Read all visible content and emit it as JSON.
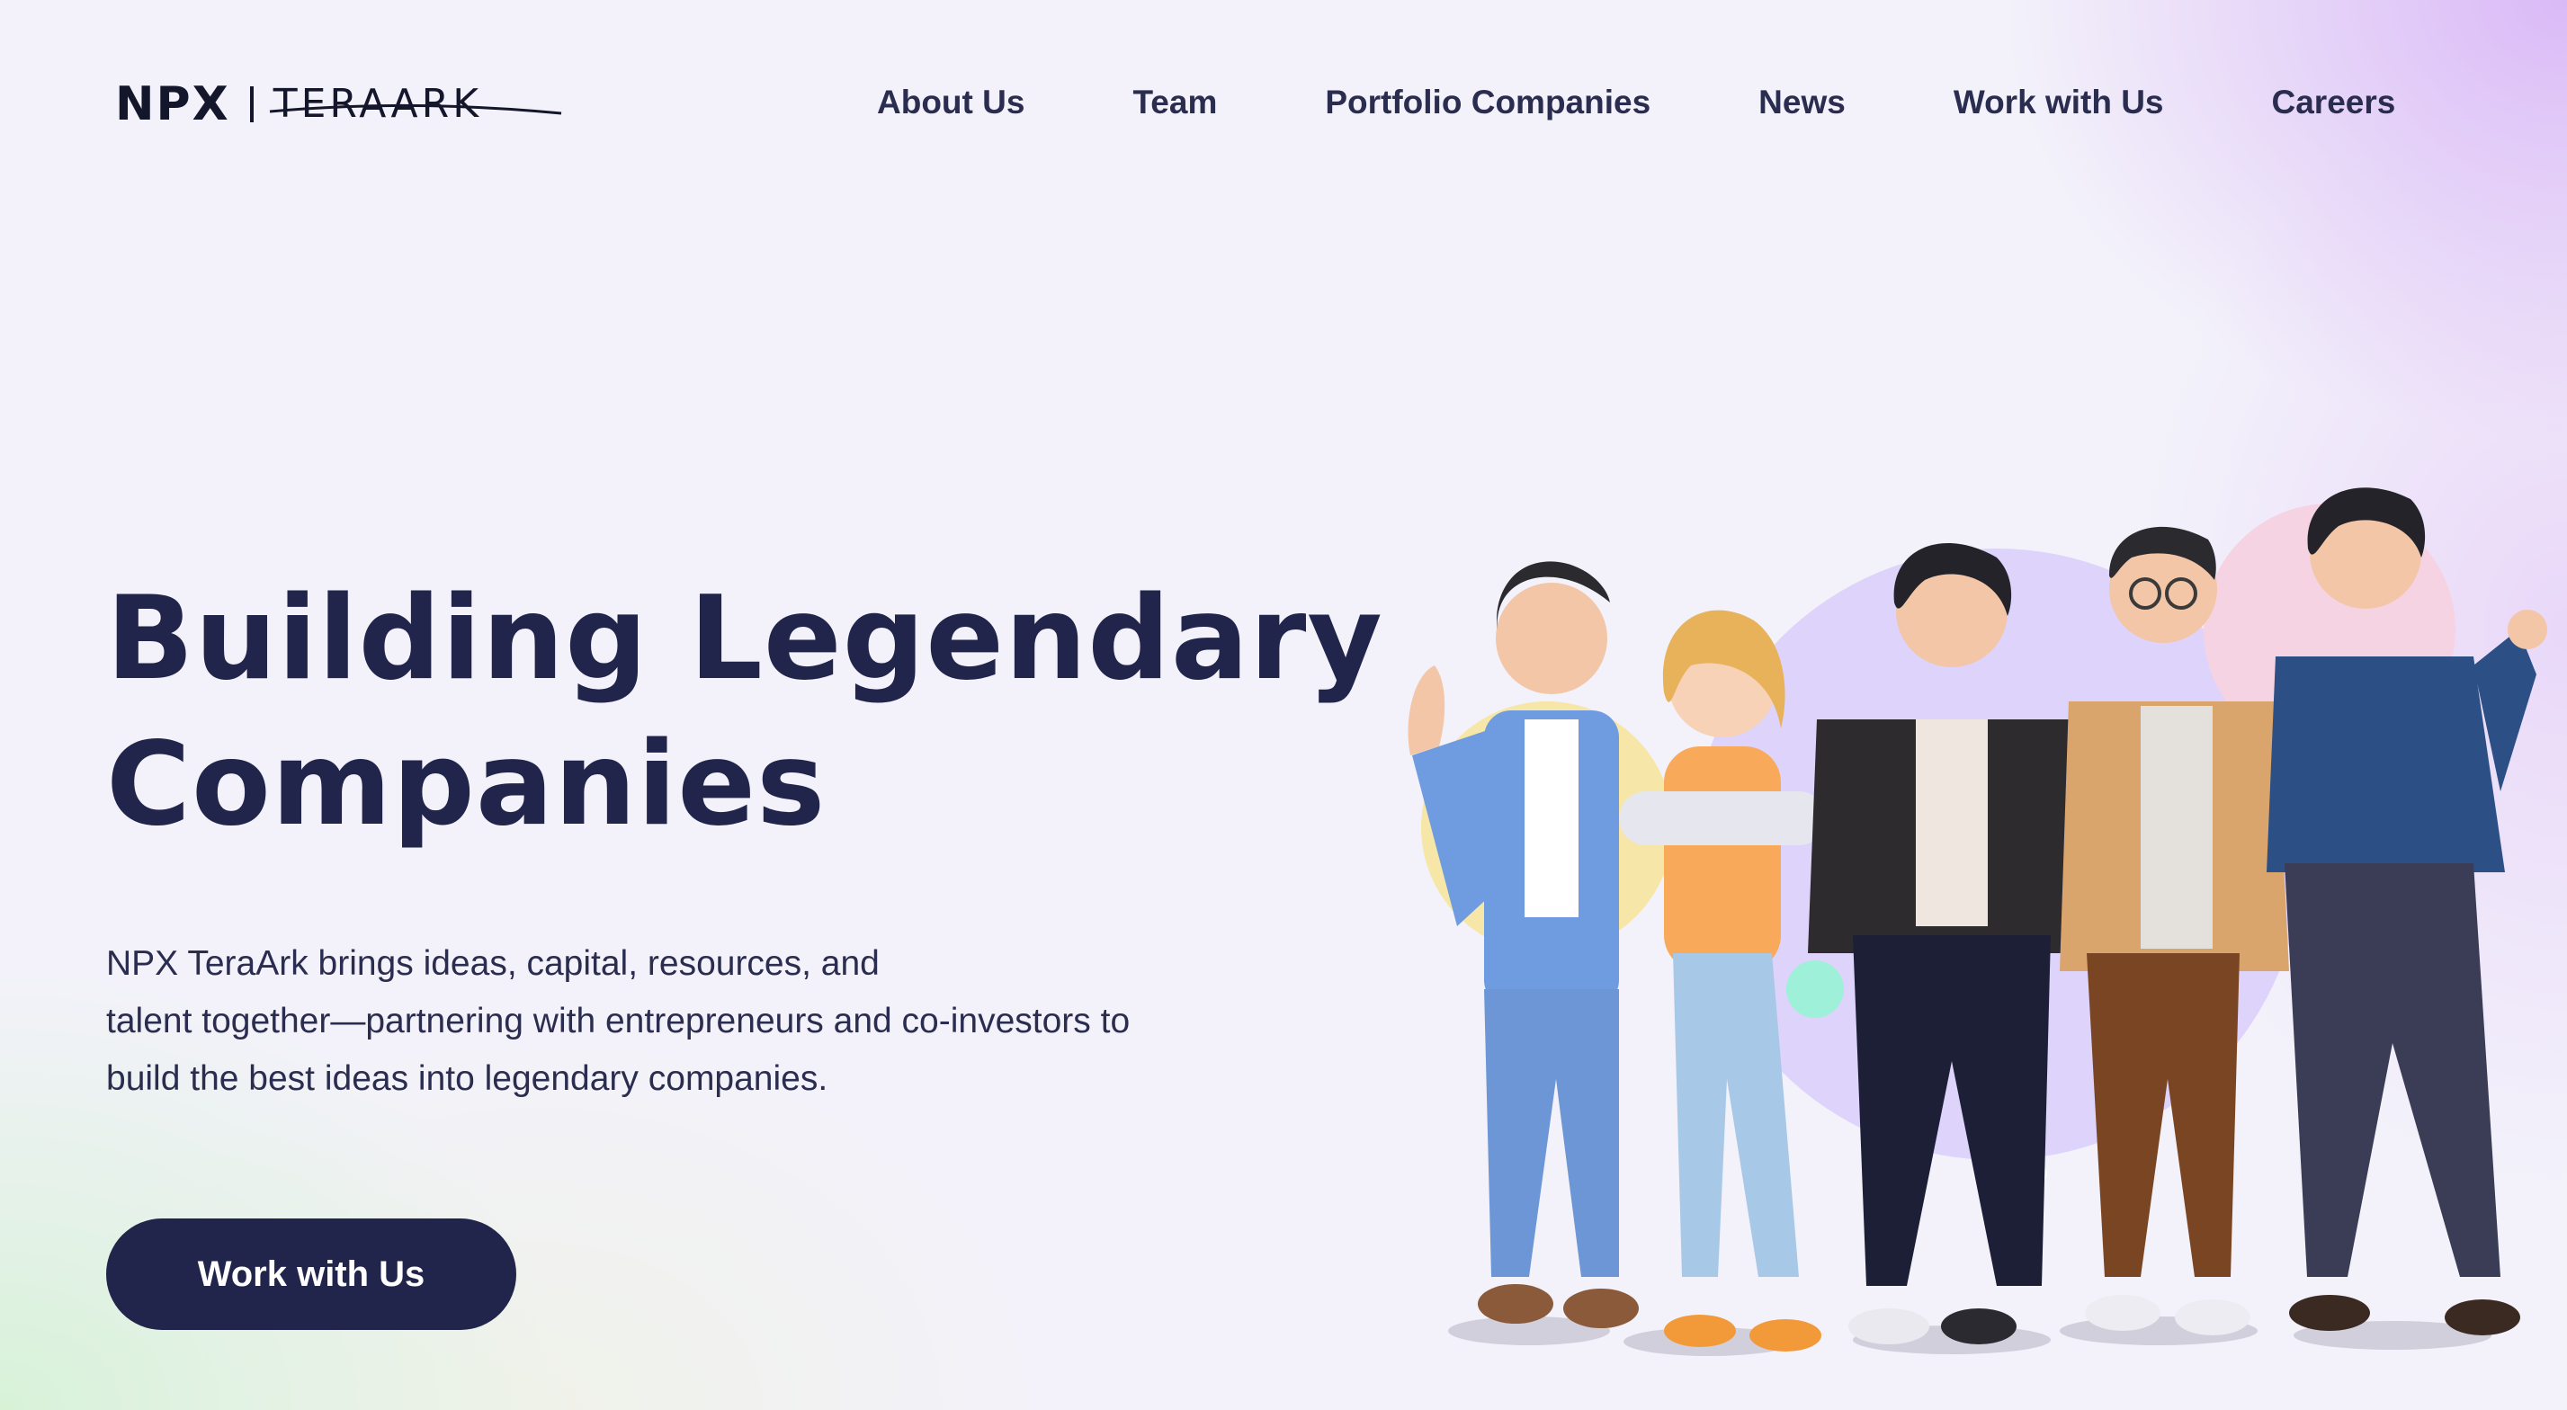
{
  "header": {
    "logo": {
      "left_text": "NPX",
      "right_text": "TERAARK"
    },
    "nav": [
      {
        "label": "About Us"
      },
      {
        "label": "Team"
      },
      {
        "label": "Portfolio Companies"
      },
      {
        "label": "News"
      },
      {
        "label": "Work with Us"
      },
      {
        "label": "Careers"
      }
    ]
  },
  "hero": {
    "title_line1": "Building Legendary",
    "title_line2": "Companies",
    "description_line1": "NPX TeraArk brings ideas, capital, resources, and",
    "description_line2": "talent together—partnering with entrepreneurs and co-investors to",
    "description_line3": "build the best ideas into legendary companies.",
    "cta_label": "Work with Us"
  },
  "illustration": {
    "subject": "five-people-group-3d",
    "colors": {
      "navy": "#22254b",
      "lavender_circle": "#ddd3fb",
      "yellow_circle": "#f6e7a8",
      "pink_circle": "#f6d3e2",
      "mint_bubble": "#9ff0d8"
    }
  }
}
